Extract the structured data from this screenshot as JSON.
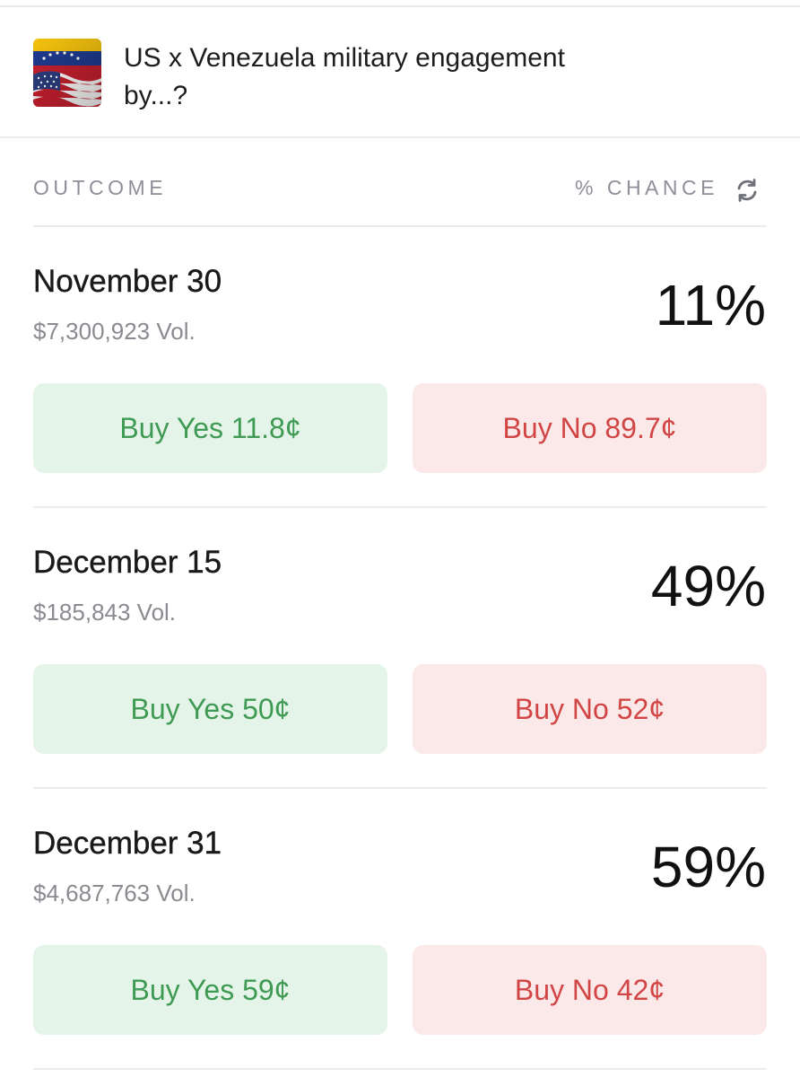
{
  "market": {
    "title": "US x Venezuela military engagement by...?",
    "thumbnail_icon": "us-venezuela-flags-icon"
  },
  "columns": {
    "outcome": "OUTCOME",
    "chance": "% CHANCE",
    "refresh_icon": "refresh-icon"
  },
  "colors": {
    "yes_bg": "#e4f4e8",
    "yes_text": "#3f9a54",
    "no_bg": "#fbe9e9",
    "no_text": "#d24545",
    "muted_text": "#8a8a90"
  },
  "outcomes": [
    {
      "label": "November 30",
      "volume": "$7,300,923 Vol.",
      "chance": "11%",
      "buy_yes": "Buy Yes 11.8¢",
      "buy_no": "Buy No 89.7¢"
    },
    {
      "label": "December 15",
      "volume": "$185,843 Vol.",
      "chance": "49%",
      "buy_yes": "Buy Yes 50¢",
      "buy_no": "Buy No 52¢"
    },
    {
      "label": "December 31",
      "volume": "$4,687,763 Vol.",
      "chance": "59%",
      "buy_yes": "Buy Yes 59¢",
      "buy_no": "Buy No 42¢"
    }
  ]
}
